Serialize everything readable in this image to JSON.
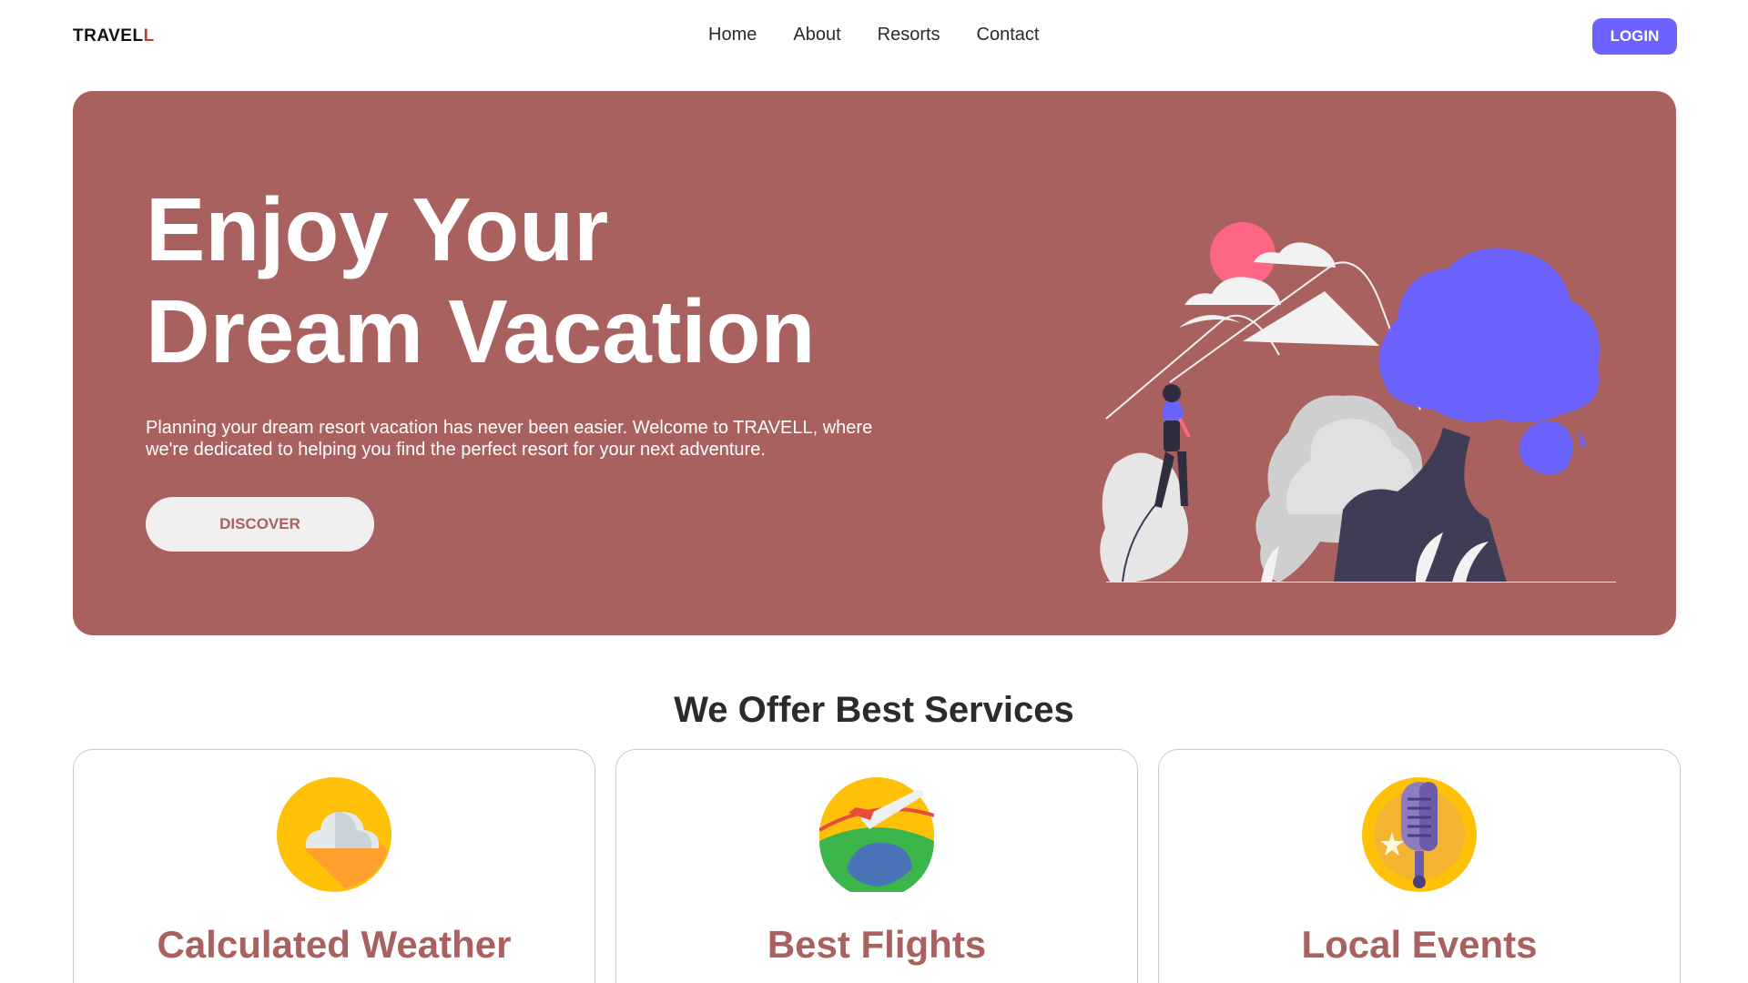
{
  "nav": {
    "logo_main": "TRAVEL",
    "logo_accent": "L",
    "links": [
      "Home",
      "About",
      "Resorts",
      "Contact"
    ],
    "login_label": "LOGIN"
  },
  "hero": {
    "title_line1": "Enjoy Your",
    "title_line2": "Dream Vacation",
    "description": "Planning your dream resort vacation has never been easier. Welcome to TRAVELL, where we're dedicated to helping you find the perfect resort for your next adventure.",
    "button_label": "DISCOVER"
  },
  "services": {
    "heading": "We Offer Best Services",
    "cards": [
      {
        "title": "Calculated Weather",
        "icon": "weather-icon"
      },
      {
        "title": "Best Flights",
        "icon": "flight-icon"
      },
      {
        "title": "Local Events",
        "icon": "microphone-icon"
      }
    ]
  },
  "colors": {
    "accent": "#6c63ff",
    "hero_bg": "#a8615e",
    "card_title": "#a8615e"
  }
}
